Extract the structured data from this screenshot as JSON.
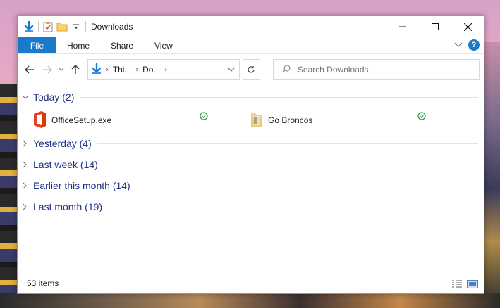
{
  "window": {
    "title": "Downloads"
  },
  "ribbon": {
    "tabs": [
      "File",
      "Home",
      "Share",
      "View"
    ]
  },
  "address": {
    "crumbs": [
      "Thi...",
      "Do..."
    ]
  },
  "search": {
    "placeholder": "Search Downloads"
  },
  "groups": [
    {
      "label": "Today (2)",
      "expanded": true
    },
    {
      "label": "Yesterday (4)",
      "expanded": false
    },
    {
      "label": "Last week (14)",
      "expanded": false
    },
    {
      "label": "Earlier this month (14)",
      "expanded": false
    },
    {
      "label": "Last month (19)",
      "expanded": false
    }
  ],
  "today_items": [
    {
      "name": "OfficeSetup.exe",
      "icon": "office-icon",
      "status": "synced"
    },
    {
      "name": "Go Broncos",
      "icon": "folder-icon",
      "status": "synced"
    }
  ],
  "status": {
    "item_count": "53 items"
  },
  "colors": {
    "accent": "#1979ca",
    "group_text": "#1e3287",
    "sync_green": "#2e9c4a"
  }
}
